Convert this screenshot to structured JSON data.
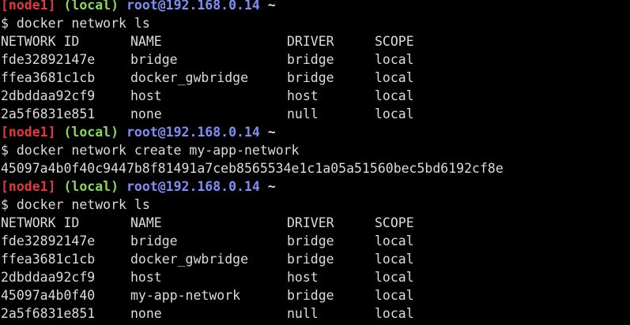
{
  "prompt": {
    "node": "[node1]",
    "local": "(local)",
    "user_host": "root@192.168.0.14",
    "tilde": "~",
    "symbol": "$"
  },
  "commands": {
    "ls": "docker network ls",
    "create": "docker network create my-app-network"
  },
  "create_output": "45097a4b0f40c9447b8f81491a7ceb8565534e1c1a05a51560bec5bd6192cf8e",
  "table_headers": [
    "NETWORK ID",
    "NAME",
    "DRIVER",
    "SCOPE"
  ],
  "table1": [
    [
      "fde32892147e",
      "bridge",
      "bridge",
      "local"
    ],
    [
      "ffea3681c1cb",
      "docker_gwbridge",
      "bridge",
      "local"
    ],
    [
      "2dbddaa92cf9",
      "host",
      "host",
      "local"
    ],
    [
      "2a5f6831e851",
      "none",
      "null",
      "local"
    ]
  ],
  "table2": [
    [
      "fde32892147e",
      "bridge",
      "bridge",
      "local"
    ],
    [
      "ffea3681c1cb",
      "docker_gwbridge",
      "bridge",
      "local"
    ],
    [
      "2dbddaa92cf9",
      "host",
      "host",
      "local"
    ],
    [
      "45097a4b0f40",
      "my-app-network",
      "bridge",
      "local"
    ],
    [
      "2a5f6831e851",
      "none",
      "null",
      "local"
    ]
  ],
  "colors": {
    "background": "#000000",
    "text": "#dcdcdc",
    "node": "#e23a3a",
    "local": "#8ad65a",
    "user_host": "#7f8ff4"
  }
}
